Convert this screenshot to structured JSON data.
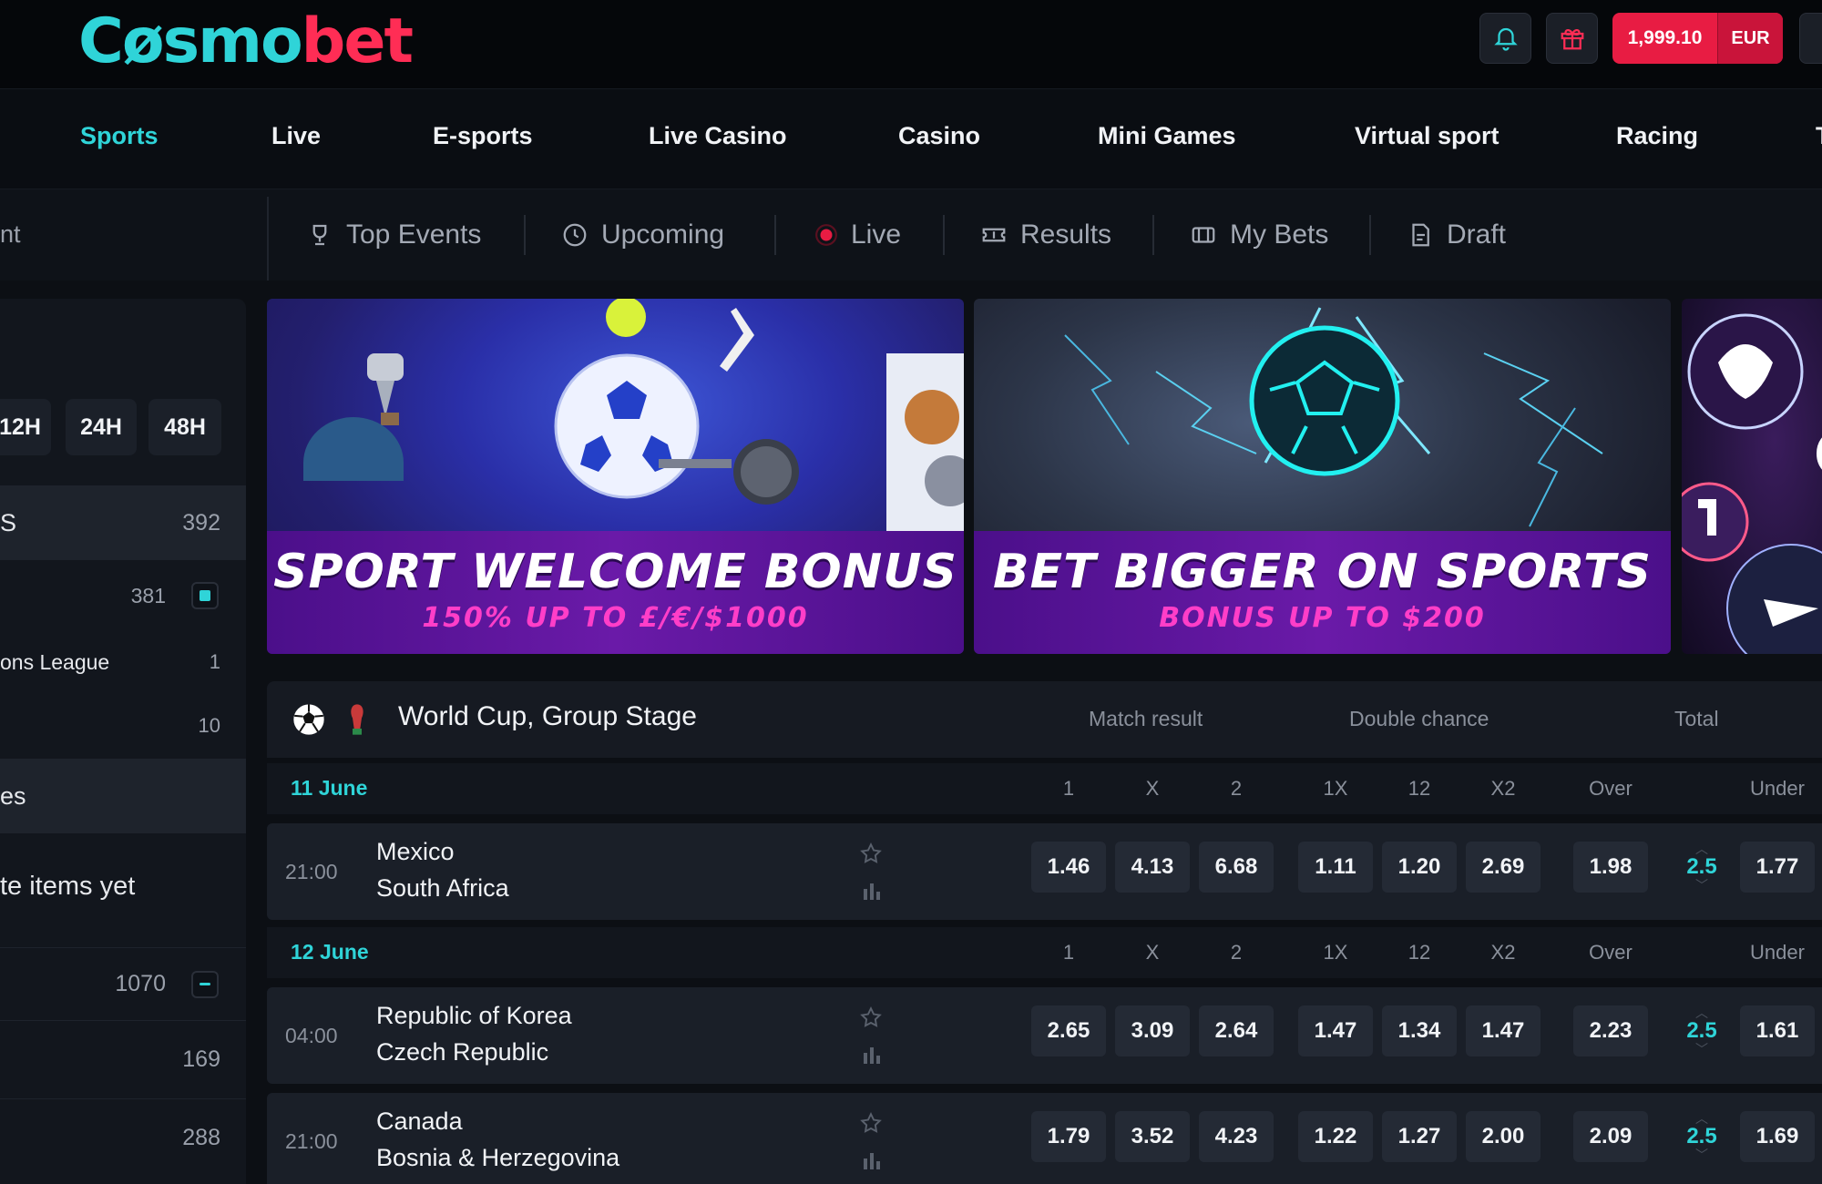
{
  "header": {
    "logo_part1": "Cøsmo",
    "logo_part2": "bet",
    "balance": "1,999.10",
    "currency": "EUR",
    "icons": [
      "bell-icon",
      "gift-icon"
    ]
  },
  "main_nav": [
    {
      "label": "Sports",
      "active": true
    },
    {
      "label": "Live"
    },
    {
      "label": "E-sports"
    },
    {
      "label": "Live Casino"
    },
    {
      "label": "Casino"
    },
    {
      "label": "Mini Games"
    },
    {
      "label": "Virtual sport"
    },
    {
      "label": "Racing"
    },
    {
      "label": "T"
    }
  ],
  "sub_nav": {
    "search_tail": "nt",
    "tabs": [
      {
        "label": "Top Events",
        "icon": "trophy-icon"
      },
      {
        "label": "Upcoming",
        "icon": "clock-icon"
      },
      {
        "label": "Live",
        "icon": "live-dot-icon"
      },
      {
        "label": "Results",
        "icon": "ticket-icon"
      },
      {
        "label": "My Bets",
        "icon": "bets-icon"
      },
      {
        "label": "Draft",
        "icon": "draft-icon"
      }
    ]
  },
  "sidebar": {
    "time_filters": [
      "12H",
      "24H",
      "48H"
    ],
    "rows": [
      {
        "label": "S",
        "count": "392"
      },
      {
        "label": "",
        "count": "381"
      },
      {
        "label": "ons League",
        "count": "1"
      },
      {
        "label": "",
        "count": "10"
      },
      {
        "label": "es",
        "count": ""
      },
      {
        "label": "te items yet",
        "count": ""
      },
      {
        "label": "",
        "count": "1070"
      },
      {
        "label": "",
        "count": "169"
      },
      {
        "label": "",
        "count": "288"
      }
    ]
  },
  "banners": [
    {
      "headline": "SPORT WELCOME BONUS",
      "subline": "150% UP TO £/€/$1000"
    },
    {
      "headline": "BET BIGGER ON SPORTS",
      "subline": "BONUS UP TO $200"
    }
  ],
  "events": {
    "league": "World Cup, Group Stage",
    "market_groups": [
      "Match result",
      "Double chance",
      "Total"
    ],
    "columns": [
      "1",
      "X",
      "2",
      "1X",
      "12",
      "X2",
      "Over",
      "Under"
    ],
    "dates": [
      {
        "label": "11 June",
        "matches": [
          {
            "time": "21:00",
            "home": "Mexico",
            "away": "South Africa",
            "odds": [
              "1.46",
              "4.13",
              "6.68",
              "1.11",
              "1.20",
              "2.69",
              "1.98",
              "1.77"
            ],
            "line": "2.5"
          }
        ]
      },
      {
        "label": "12 June",
        "matches": [
          {
            "time": "04:00",
            "home": "Republic of Korea",
            "away": "Czech Republic",
            "odds": [
              "2.65",
              "3.09",
              "2.64",
              "1.47",
              "1.34",
              "1.47",
              "2.23",
              "1.61"
            ],
            "line": "2.5"
          },
          {
            "time": "21:00",
            "home": "Canada",
            "away": "Bosnia & Herzegovina",
            "odds": [
              "1.79",
              "3.52",
              "4.23",
              "1.22",
              "1.27",
              "2.00",
              "2.09",
              "1.69"
            ],
            "line": "2.5"
          }
        ]
      }
    ]
  }
}
